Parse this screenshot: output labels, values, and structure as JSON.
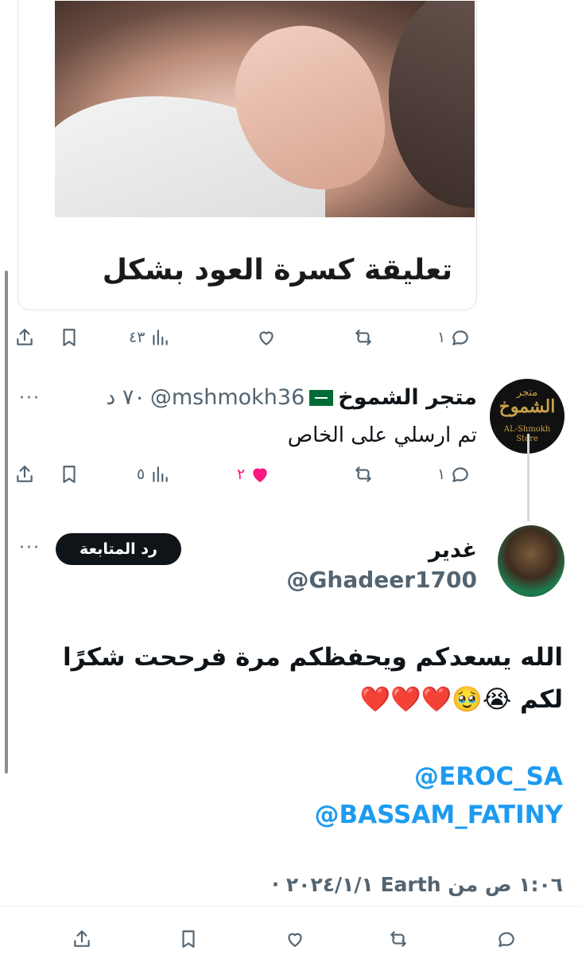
{
  "media": {
    "caption": "تعليقة كسرة العود بشكل"
  },
  "tweet1_actions": {
    "reply_count": "١",
    "retweet_count": "",
    "like_count": "",
    "views_count": "٤٣"
  },
  "reply1": {
    "name": "متجر الشموخ",
    "flag_icon": "saudi-flag-icon",
    "handle": "@mshmokh36",
    "time": "٧٠ د",
    "text": "تم ارسلي على الخاص",
    "avatar_text_top": "متجر",
    "avatar_text_logo": "الشموخ",
    "avatar_text_en1": "AL-Shmokh",
    "avatar_text_en2": "Store",
    "actions": {
      "reply_count": "١",
      "like_count": "٢",
      "views_count": "٥"
    }
  },
  "main_tweet": {
    "name": "غدير",
    "handle": "@Ghadeer1700",
    "follow_button": "رد المتابعة",
    "line1": "الله يسعدكم ويحفظكم مرة فرححت شكرًا",
    "line2": "لكم 😭🥹❤️❤️❤️",
    "mention1": "@EROC_SA",
    "mention2": "@BASSAM_FATINY",
    "timestamp": "١:٠٦ ص من Earth ٢٠٢٤/١/١ ·"
  },
  "colors": {
    "accent": "#1d9bf0",
    "like": "#f91880",
    "muted": "#536471"
  }
}
